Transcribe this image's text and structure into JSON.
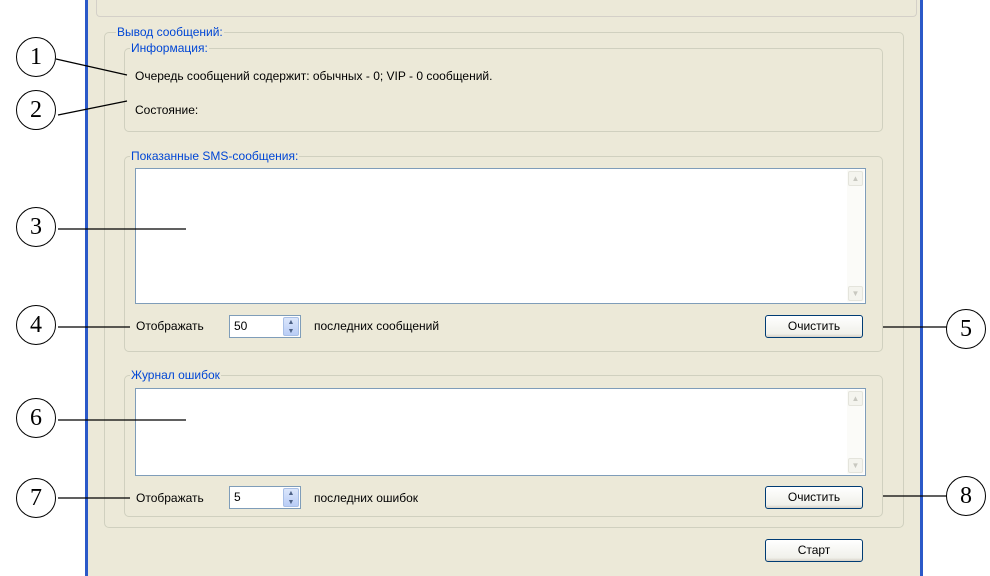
{
  "output_group": {
    "title": "Вывод сообщений:"
  },
  "info_group": {
    "title": "Информация:",
    "queue_text": "Очередь сообщений содержит: обычных - 0; VIP - 0 сообщений.",
    "state_label": "Состояние:"
  },
  "sms_group": {
    "title": "Показанные SMS-сообщения:",
    "show_label": "Отображать",
    "count_value": "50",
    "suffix_label": "последних сообщений",
    "clear_button": "Очистить"
  },
  "errors_group": {
    "title": "Журнал ошибок",
    "show_label": "Отображать",
    "count_value": "5",
    "suffix_label": "последних ошибок",
    "clear_button": "Очистить"
  },
  "start_button": "Старт",
  "callouts": [
    "1",
    "2",
    "3",
    "4",
    "5",
    "6",
    "7",
    "8"
  ]
}
